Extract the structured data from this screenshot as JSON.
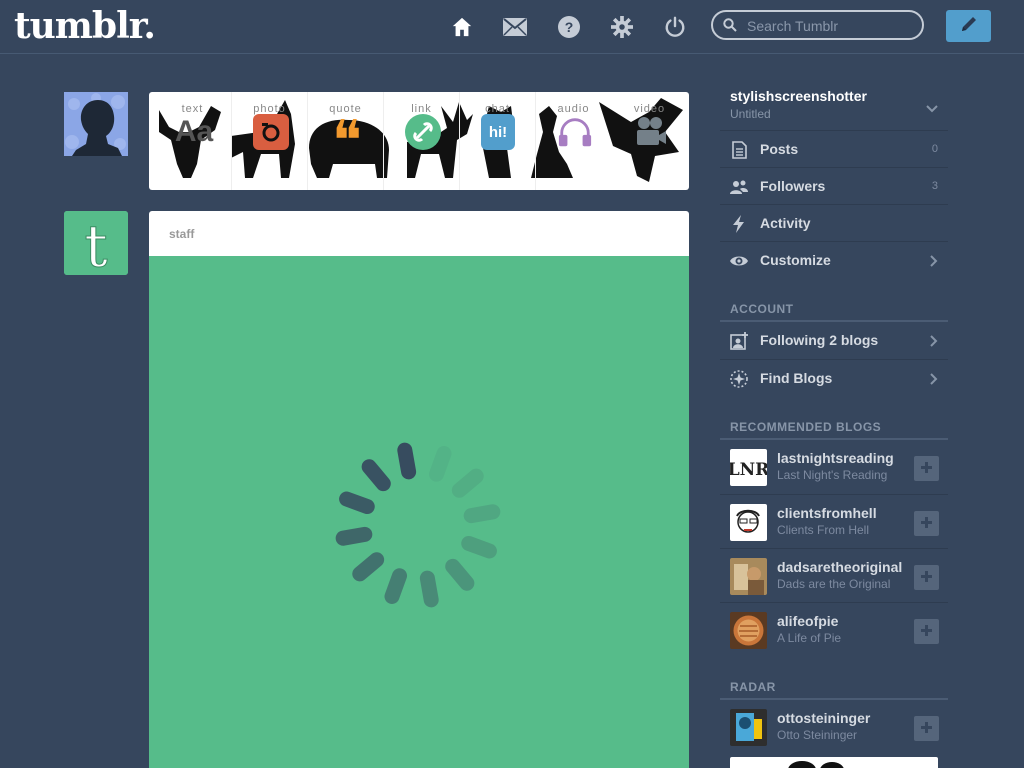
{
  "header": {
    "logo": "tumblr.",
    "search_placeholder": "Search Tumblr",
    "nav": [
      "home-icon",
      "mail-icon",
      "help-icon",
      "gear-icon",
      "power-icon"
    ],
    "compose_icon": "pencil-icon"
  },
  "post_types": [
    {
      "label": "text",
      "glyph": "Aa",
      "color": "#444444"
    },
    {
      "label": "photo",
      "glyph": "◉",
      "color": "#d95e40"
    },
    {
      "label": "quote",
      "glyph": "❝",
      "color": "#f2992e"
    },
    {
      "label": "link",
      "glyph": "∞",
      "color": "#56bc8a"
    },
    {
      "label": "chat",
      "glyph": "hi!",
      "color": "#529ecc"
    },
    {
      "label": "audio",
      "glyph": "♫",
      "color": "#a77dc2"
    },
    {
      "label": "video",
      "glyph": "▶",
      "color": "#748089"
    }
  ],
  "post": {
    "author": "staff"
  },
  "sidebar": {
    "blog_name": "stylishscreenshotter",
    "blog_subtitle": "Untitled",
    "menu": [
      {
        "label": "Posts",
        "count": "0",
        "icon": "posts-icon"
      },
      {
        "label": "Followers",
        "count": "3",
        "icon": "followers-icon"
      },
      {
        "label": "Activity",
        "icon": "activity-icon"
      },
      {
        "label": "Customize",
        "icon": "eye-icon"
      }
    ],
    "account_heading": "ACCOUNT",
    "account": [
      {
        "label": "Following 2 blogs",
        "icon": "following-icon"
      },
      {
        "label": "Find Blogs",
        "icon": "find-blogs-icon"
      }
    ],
    "recommended_heading": "RECOMMENDED BLOGS",
    "recommended": [
      {
        "name": "lastnightsreading",
        "title": "Last Night's Reading"
      },
      {
        "name": "clientsfromhell",
        "title": "Clients From Hell"
      },
      {
        "name": "dadsaretheoriginal",
        "title": "Dads are the Original"
      },
      {
        "name": "alifeofpie",
        "title": "A Life of Pie"
      }
    ],
    "radar_heading": "RADAR",
    "radar": {
      "name": "ottosteininger",
      "title": "Otto Steininger"
    }
  },
  "colors": {
    "background": "#36465d",
    "accent": "#529ecc",
    "staff_green": "#56bc8a"
  }
}
